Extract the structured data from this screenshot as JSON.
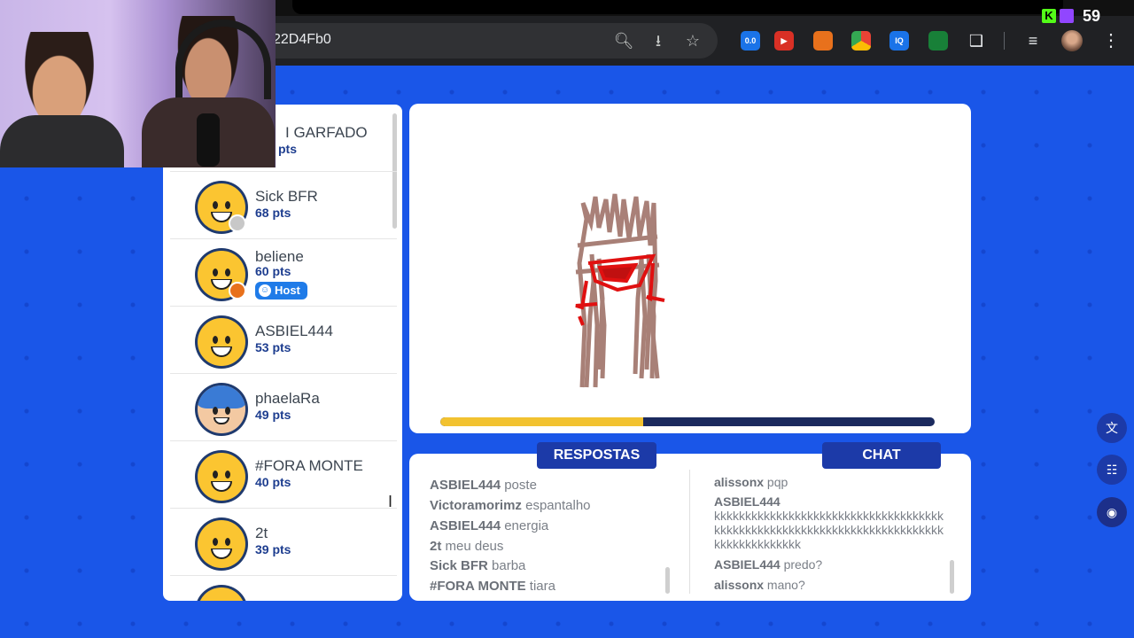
{
  "browser": {
    "url_fragment": "22D4Fb0",
    "extension_badge": "0.0"
  },
  "stream": {
    "viewer_count": "59"
  },
  "players": [
    {
      "name": "I GARFADO",
      "pts": "pts",
      "avatar": "yellow"
    },
    {
      "name": "Sick BFR",
      "pts": "68 pts",
      "avatar": "yellow",
      "dot": "#c8c8c8"
    },
    {
      "name": "beliene",
      "pts": "60 pts",
      "avatar": "yellow",
      "dot": "#e8711c",
      "host": "Host"
    },
    {
      "name": "ASBIEL444",
      "pts": "53 pts",
      "avatar": "yellow"
    },
    {
      "name": "phaelaRa",
      "pts": "49 pts",
      "avatar": "blue-hair"
    },
    {
      "name": "#FORA MONTE",
      "pts": "40 pts",
      "avatar": "yellow"
    },
    {
      "name": "2t",
      "pts": "39 pts",
      "avatar": "yellow"
    }
  ],
  "timer": {
    "progress": 0.41
  },
  "tabs": {
    "answers": "RESPOSTAS",
    "chat": "CHAT"
  },
  "answers": [
    {
      "user": "ASBIEL444",
      "text": "poste"
    },
    {
      "user": "Victoramorimz",
      "text": "espantalho"
    },
    {
      "user": "ASBIEL444",
      "text": "energia"
    },
    {
      "user": "2t",
      "text": "meu deus"
    },
    {
      "user": "Sick BFR",
      "text": "barba"
    },
    {
      "user": "#FORA MONTE",
      "text": "tiara"
    }
  ],
  "chat": {
    "m1_user": "alissonx",
    "m1_text": "pqp",
    "m2_user": "ASBIEL444",
    "m2_text": "kkkkkkkkkkkkkkkkkkkkkkkkkkkkkkkkkkkkkkkkkkkkkkkkkkkkkkkkkkkkkkkkkkkkkkkkkkkkkkkkkkkkkkkk",
    "m3_user": "ASBIEL444",
    "m3_text": "predo?",
    "m4_user": "alissonx",
    "m4_text": "mano?"
  },
  "colors": {
    "background": "#1a56e8",
    "accent": "#1c3aa8",
    "timer": "#f2c230",
    "drawing_brown": "#9a6a60",
    "drawing_red": "#e01010"
  },
  "icons": [
    "zoom-icon",
    "install-icon",
    "star-icon",
    "extensions-icon",
    "translate-icon",
    "grid-icon",
    "bot-icon"
  ]
}
